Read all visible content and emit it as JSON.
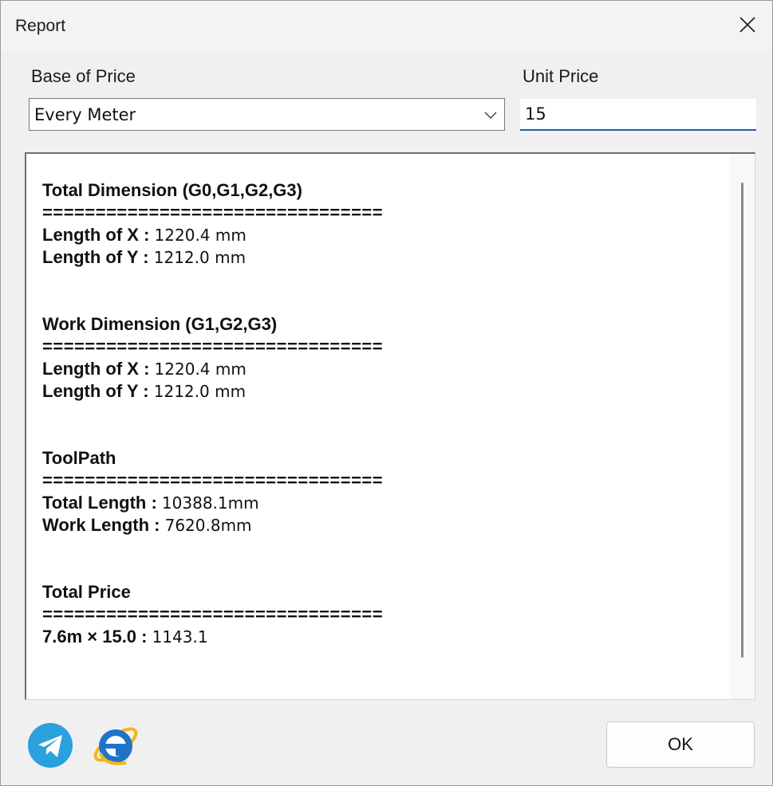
{
  "window": {
    "title": "Report"
  },
  "base_of_price": {
    "label": "Base of Price",
    "selected": "Every Meter"
  },
  "unit_price": {
    "label": "Unit Price",
    "value": "15"
  },
  "report": {
    "separator": "================================",
    "total_dimension": {
      "heading": "Total Dimension (G0,G1,G2,G3)",
      "x_label": "Length of X :",
      "x_value": "1220.4 mm",
      "y_label": "Length of Y :",
      "y_value": "1212.0 mm"
    },
    "work_dimension": {
      "heading": "Work Dimension (G1,G2,G3)",
      "x_label": "Length of X :",
      "x_value": "1220.4 mm",
      "y_label": "Length of Y :",
      "y_value": "1212.0 mm"
    },
    "toolpath": {
      "heading": "ToolPath",
      "total_label": "Total Length :",
      "total_value": "10388.1mm",
      "work_label": "Work Length :",
      "work_value": "7620.8mm"
    },
    "total_price": {
      "heading": "Total Price",
      "formula_label": "7.6m × 15.0 :",
      "value": "1143.1"
    }
  },
  "footer": {
    "ok_label": "OK"
  },
  "icons": {
    "telegram": "telegram-icon",
    "browser": "internet-explorer-icon"
  },
  "colors": {
    "accent": "#1f5ea8",
    "telegram": "#2aa0dc",
    "ie": "#1f74c8"
  }
}
